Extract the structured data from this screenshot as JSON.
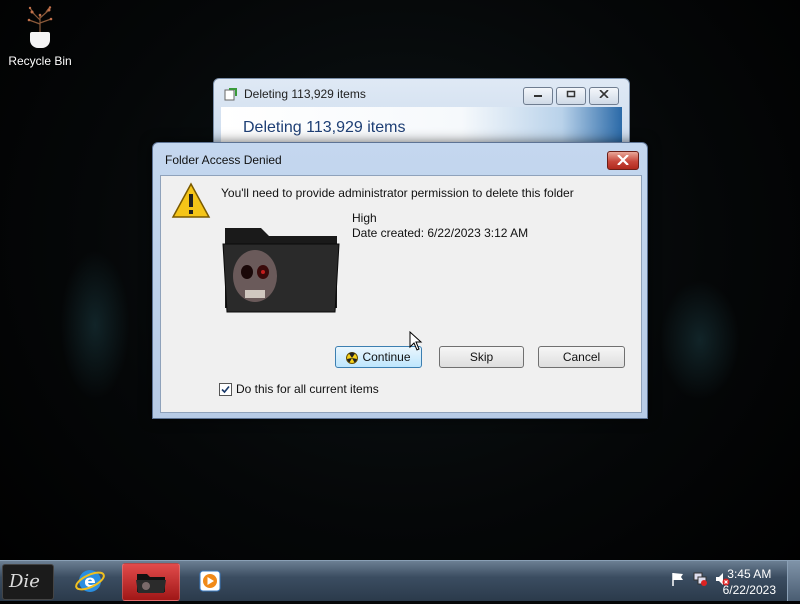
{
  "desktop": {
    "icons": [
      {
        "label": "Recycle Bin",
        "icon": "recycle-bin-icon"
      }
    ]
  },
  "progress_window": {
    "title": "Deleting 113,929 items",
    "banner": "Deleting 113,929 items",
    "buttons": {
      "minimize": "minimize-icon",
      "maximize": "maximize-icon",
      "close": "close-icon"
    }
  },
  "dialog": {
    "title": "Folder Access Denied",
    "message": "You'll need to provide administrator permission to delete this folder",
    "folder_name": "High",
    "date_created": "Date created: 6/22/2023 3:12 AM",
    "buttons": {
      "continue": "Continue",
      "skip": "Skip",
      "cancel": "Cancel"
    },
    "checkbox_label": "Do this for all current items",
    "checkbox_checked": true
  },
  "taskbar": {
    "start_label": "Die",
    "pinned": [
      {
        "name": "internet-explorer",
        "icon": "ie-icon"
      },
      {
        "name": "windows-explorer",
        "icon": "folder-icon",
        "active": true
      },
      {
        "name": "media-player",
        "icon": "media-player-icon"
      }
    ],
    "tray_icons": [
      "action-center-icon",
      "network-icon",
      "volume-muted-icon"
    ],
    "clock": {
      "time": "3:45 AM",
      "date": "6/22/2023"
    }
  }
}
